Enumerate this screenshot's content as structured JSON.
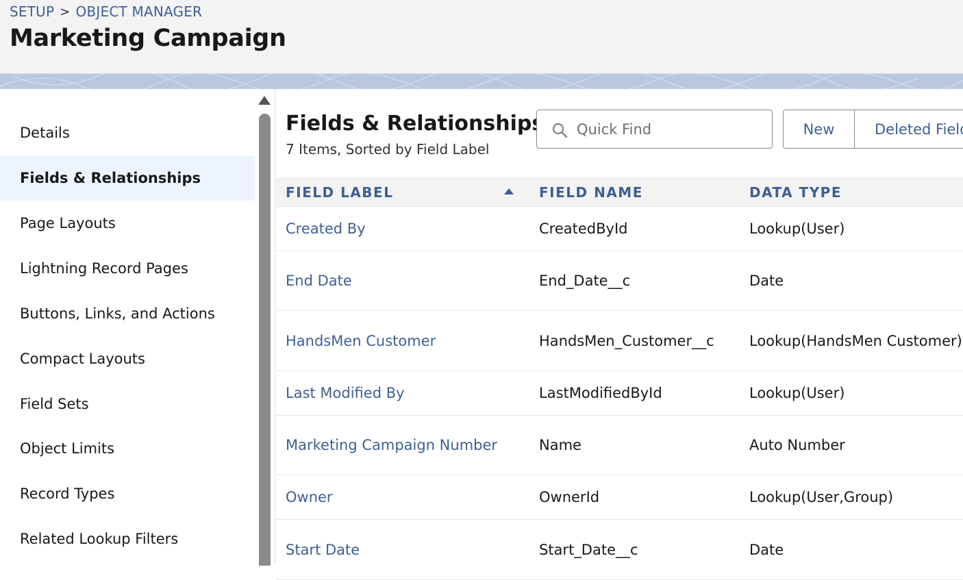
{
  "header": {
    "breadcrumb": {
      "setup": "SETUP",
      "separator": ">",
      "object_manager": "OBJECT MANAGER"
    },
    "title": "Marketing Campaign"
  },
  "sidebar": {
    "items": [
      {
        "label": "Details",
        "active": false
      },
      {
        "label": "Fields & Relationships",
        "active": true
      },
      {
        "label": "Page Layouts",
        "active": false
      },
      {
        "label": "Lightning Record Pages",
        "active": false
      },
      {
        "label": "Buttons, Links, and Actions",
        "active": false
      },
      {
        "label": "Compact Layouts",
        "active": false
      },
      {
        "label": "Field Sets",
        "active": false
      },
      {
        "label": "Object Limits",
        "active": false
      },
      {
        "label": "Record Types",
        "active": false
      },
      {
        "label": "Related Lookup Filters",
        "active": false
      }
    ]
  },
  "main": {
    "title": "Fields & Relationships",
    "subtitle": "7 Items, Sorted by Field Label",
    "quick_find": {
      "placeholder": "Quick Find",
      "value": "",
      "icon": "search-icon"
    },
    "buttons": {
      "new": "New",
      "deleted": "Deleted Fields"
    },
    "table": {
      "columns": [
        "FIELD LABEL",
        "FIELD NAME",
        "DATA TYPE"
      ],
      "sort": {
        "column": "FIELD LABEL",
        "direction": "ascending"
      },
      "rows": [
        {
          "label": "Created By",
          "name": "CreatedById",
          "type": "Lookup(User)"
        },
        {
          "label": "End Date",
          "name": "End_Date__c",
          "type": "Date"
        },
        {
          "label": "HandsMen Customer",
          "name": "HandsMen_Customer__c",
          "type": "Lookup(HandsMen Customer)"
        },
        {
          "label": "Last Modified By",
          "name": "LastModifiedById",
          "type": "Lookup(User)"
        },
        {
          "label": "Marketing Campaign Number",
          "name": "Name",
          "type": "Auto Number"
        },
        {
          "label": "Owner",
          "name": "OwnerId",
          "type": "Lookup(User,Group)"
        },
        {
          "label": "Start Date",
          "name": "Start_Date__c",
          "type": "Date"
        }
      ]
    }
  },
  "colors": {
    "link": "#3e5f94",
    "header_bg": "#f3f3f3",
    "active_bg": "#eef4ff",
    "band": "#b9c8dc"
  }
}
